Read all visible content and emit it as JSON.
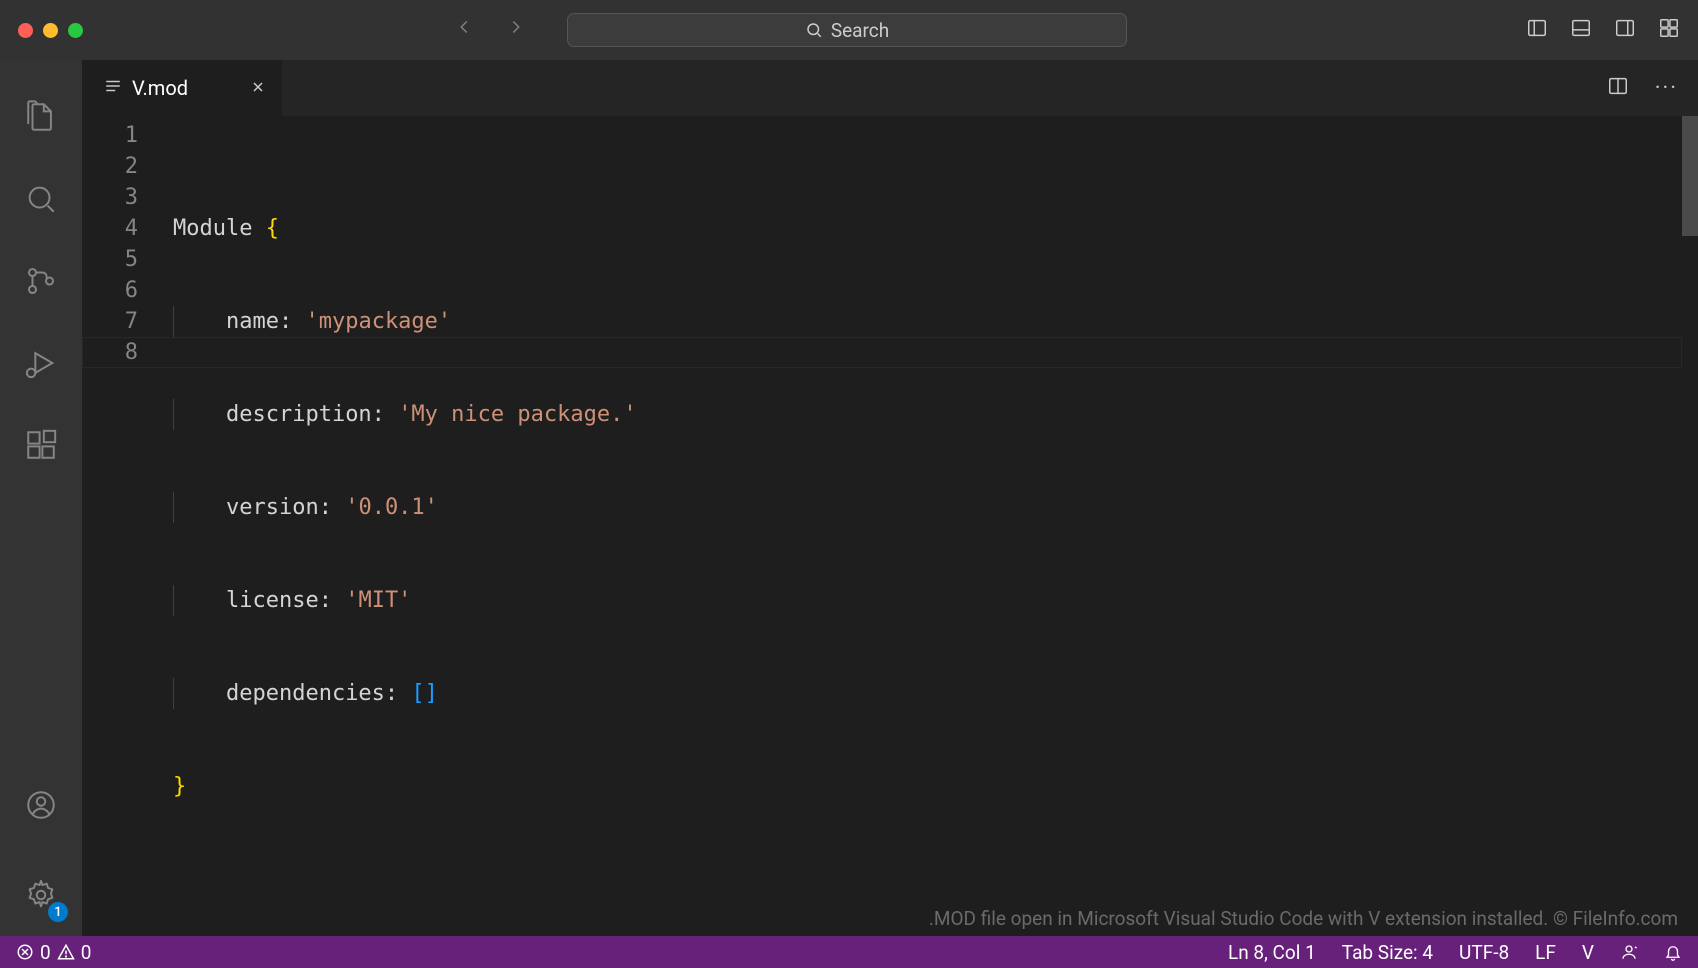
{
  "titlebar": {
    "search_placeholder": "Search"
  },
  "activity": {
    "settings_badge": "1"
  },
  "tab": {
    "filename": "V.mod"
  },
  "code": {
    "line_numbers": [
      "1",
      "2",
      "3",
      "4",
      "5",
      "6",
      "7",
      "8"
    ],
    "l1_keyword": "Module ",
    "l1_brace": "{",
    "l2_prop": "name:",
    "l2_val": "'mypackage'",
    "l3_prop": "description:",
    "l3_val": "'My nice package.'",
    "l4_prop": "version:",
    "l4_val": "'0.0.1'",
    "l5_prop": "license:",
    "l5_val": "'MIT'",
    "l6_prop": "dependencies:",
    "l6_val": "[]",
    "l7_brace": "}"
  },
  "watermark": ".MOD file open in Microsoft Visual Studio Code with V extension installed. © FileInfo.com",
  "status": {
    "errors": "0",
    "warnings": "0",
    "cursor": "Ln 8, Col 1",
    "tabsize": "Tab Size: 4",
    "encoding": "UTF-8",
    "eol": "LF",
    "language": "V"
  }
}
